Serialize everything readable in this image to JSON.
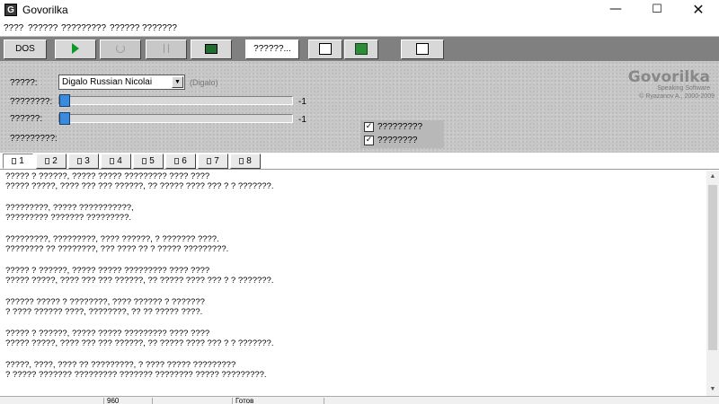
{
  "window": {
    "icon_letter": "G",
    "title": "Govorilka",
    "minimize": "—",
    "maximize": "☐",
    "close": "✕"
  },
  "menu": [
    "????",
    "??????",
    "?????????",
    "??????",
    "???????"
  ],
  "toolbar": {
    "dos_label": "DOS",
    "text_button_label": "??????..."
  },
  "settings": {
    "voice_label": "?????:",
    "voice_value": "Digalo Russian Nicolai",
    "engine_label": "(Digalo)",
    "speed_label": "????????:",
    "speed_value": "-1",
    "volume_label": "??????:",
    "volume_value": "-1",
    "extra_label": "?????????:",
    "checkbox1_label": "?????????",
    "checkbox2_label": "????????",
    "checkbox_mark": "✓"
  },
  "logo": {
    "title": "Govorilka",
    "subtitle": "Speaking Software",
    "copyright": "© Ryazanov A., 2000-2009"
  },
  "tabs": [
    "1",
    "2",
    "3",
    "4",
    "5",
    "6",
    "7",
    "8"
  ],
  "text_lines": [
    "????? ? ??????, ????? ????? ????????? ???? ????",
    "????? ?????, ???? ??? ??? ??????, ?? ????? ???? ??? ? ? ???????.",
    "?????????, ????? ???????????,",
    "????????? ??????? ?????????.",
    "?????????, ?????????, ???? ??????, ? ??????? ????.",
    "???????? ?? ????????, ??? ???? ?? ? ????? ?????????.",
    "????? ? ??????, ????? ????? ????????? ???? ????",
    "????? ?????, ???? ??? ??? ??????, ?? ????? ???? ??? ? ? ???????.",
    "?????? ????? ? ????????, ???? ?????? ? ???????",
    "? ???? ?????? ????, ????????, ?? ?? ????? ????.",
    "????? ? ??????, ????? ????? ????????? ???? ????",
    "????? ?????, ???? ??? ??? ??????, ?? ????? ???? ??? ? ? ???????.",
    "?????, ????, ???? ?? ?????????, ? ???? ????? ?????????",
    "? ????? ??????? ????????? ??????? ???????? ????? ?????????."
  ],
  "status": {
    "count": "960",
    "state": "Готов"
  },
  "scroll": {
    "up": "▲",
    "down": "▼"
  }
}
